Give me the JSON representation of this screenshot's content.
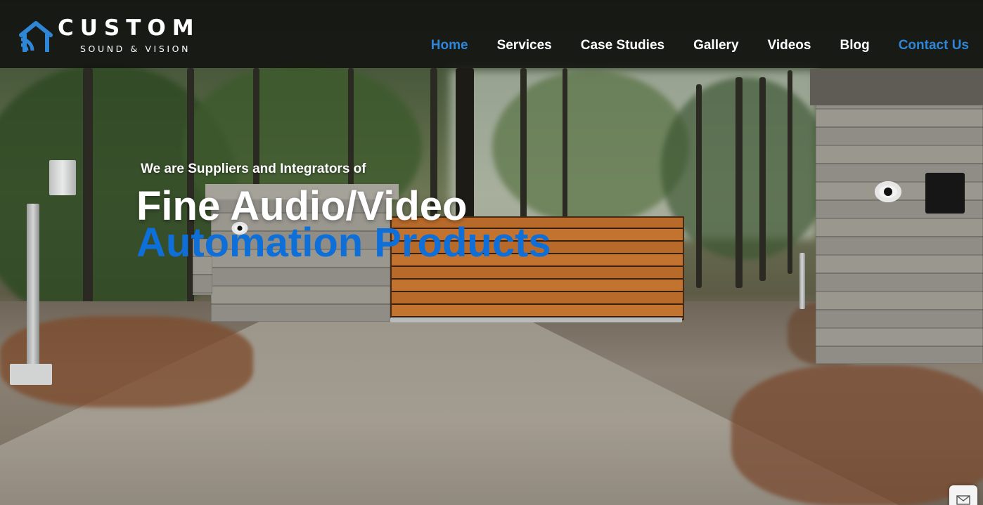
{
  "brand": {
    "name": "CUSTOM",
    "tagline": "SOUND & VISION",
    "accent_color": "#2f86d6",
    "logo_icon": "house-wifi-icon"
  },
  "nav": {
    "items": [
      {
        "label": "Home",
        "active": true
      },
      {
        "label": "Services",
        "active": false
      },
      {
        "label": "Case Studies",
        "active": false
      },
      {
        "label": "Gallery",
        "active": false
      },
      {
        "label": "Videos",
        "active": false
      },
      {
        "label": "Blog",
        "active": false
      },
      {
        "label": "Contact Us",
        "active": false
      }
    ]
  },
  "hero": {
    "eyebrow": "We are Suppliers and Integrators of",
    "headline_line1": "Fine Audio/Video",
    "headline_line2": "Automation Products",
    "headline_line2_color": "#0f6fd8"
  },
  "chat_widget": {
    "icon": "envelope-icon"
  }
}
